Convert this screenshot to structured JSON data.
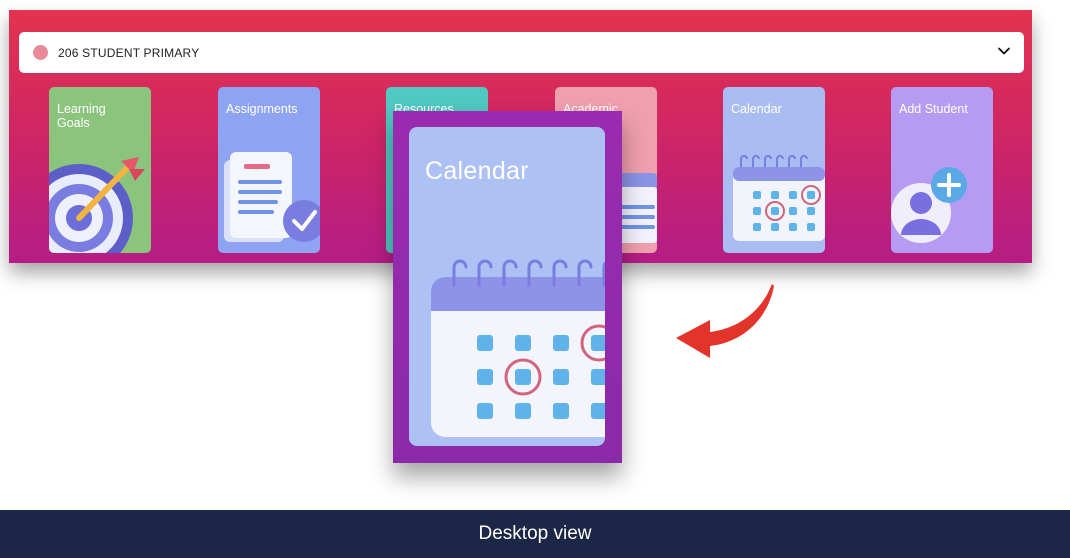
{
  "selector": {
    "label": "206 STUDENT PRIMARY",
    "dot_color": "#e88a97"
  },
  "tiles": [
    {
      "label": "Learning Goals",
      "color": "#8bc47c",
      "icon": "target-icon"
    },
    {
      "label": "Assignments",
      "color": "#8ea3f1",
      "icon": "assignment-check-icon"
    },
    {
      "label": "Resources.",
      "color": "#4fc9c2",
      "icon": "resources-icon"
    },
    {
      "label": "Academic",
      "color": "#ef9fae",
      "icon": "academic-icon"
    },
    {
      "label": "Calendar",
      "color": "#a9bdf3",
      "icon": "calendar-icon"
    },
    {
      "label": "Add Student",
      "color": "#b69bf2",
      "icon": "add-student-icon"
    }
  ],
  "zoom_card": {
    "label": "Calendar",
    "icon": "calendar-icon"
  },
  "footer": {
    "caption": "Desktop view"
  },
  "colors": {
    "banner_top": "#e4334f",
    "banner_bottom": "#b41d86",
    "footer_bg": "#1c2647",
    "arrow": "#e3342c"
  }
}
